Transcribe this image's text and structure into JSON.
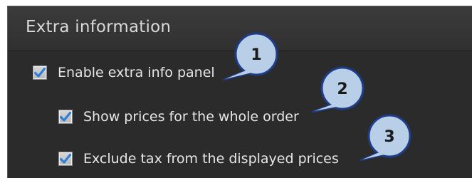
{
  "section": {
    "title": "Extra information"
  },
  "options": [
    {
      "label": "Enable extra info panel",
      "checked": true
    },
    {
      "label": "Show prices for the whole order",
      "checked": true
    },
    {
      "label": "Exclude tax from the displayed prices",
      "checked": true
    }
  ],
  "callouts": [
    {
      "number": "1"
    },
    {
      "number": "2"
    },
    {
      "number": "3"
    }
  ],
  "colors": {
    "panel_bg": "#2b2b2b",
    "header_bg": "#353535",
    "checkmark": "#2f7fd6",
    "callout_fill": "#b9cfe8",
    "callout_border": "#1f3c87"
  }
}
